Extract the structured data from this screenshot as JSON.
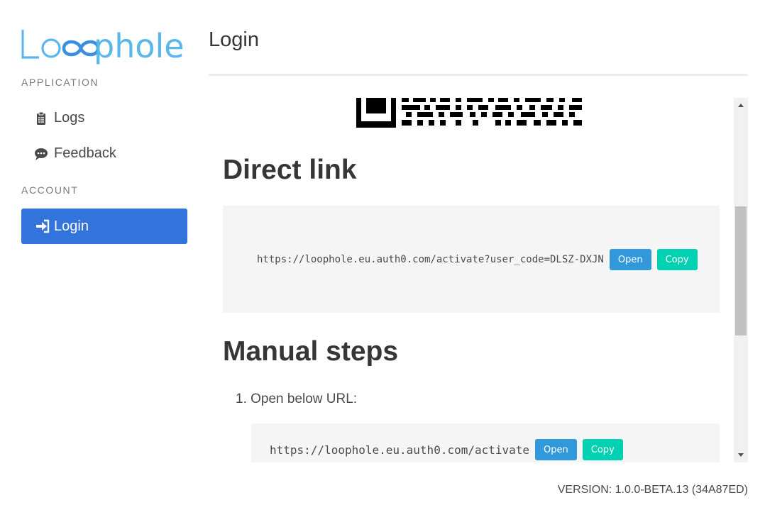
{
  "app": {
    "logo_text": "Loophole"
  },
  "sidebar": {
    "application_label": "APPLICATION",
    "items": [
      {
        "label": "Logs",
        "icon": "clipboard-list-icon"
      },
      {
        "label": "Feedback",
        "icon": "comment-dots-icon"
      }
    ],
    "account_label": "ACCOUNT",
    "active_item": {
      "label": "Login",
      "icon": "sign-in-icon"
    }
  },
  "header": {
    "title": "Login"
  },
  "content": {
    "direct_link_heading": "Direct link",
    "direct_link": {
      "url": "https://loophole.eu.auth0.com/activate?user_code=DLSZ-DXJN",
      "open_label": "Open",
      "copy_label": "Copy"
    },
    "manual_steps_heading": "Manual steps",
    "steps": [
      {
        "text": "Open below URL:",
        "url": "https://loophole.eu.auth0.com/activate",
        "open_label": "Open",
        "copy_label": "Copy"
      }
    ]
  },
  "footer": {
    "version": "VERSION: 1.0.0-BETA.13 (34A87ED)"
  },
  "colors": {
    "primary": "#3273dc",
    "info": "#3298dc",
    "success": "#00d1b2",
    "logo": "#4fb3e8"
  }
}
